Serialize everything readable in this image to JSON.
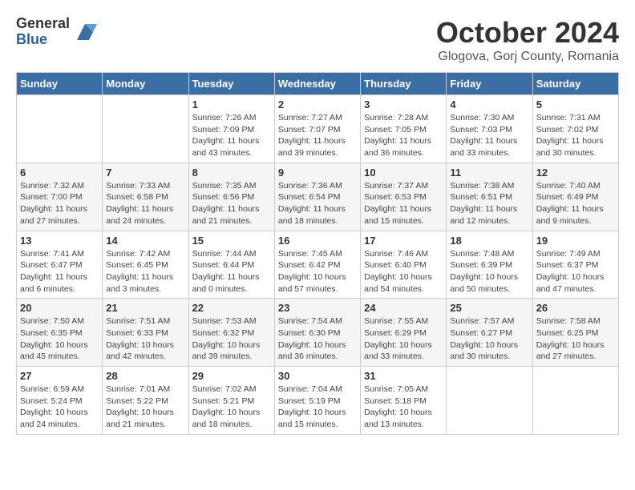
{
  "logo": {
    "general": "General",
    "blue": "Blue"
  },
  "header": {
    "month": "October 2024",
    "location": "Glogova, Gorj County, Romania"
  },
  "weekdays": [
    "Sunday",
    "Monday",
    "Tuesday",
    "Wednesday",
    "Thursday",
    "Friday",
    "Saturday"
  ],
  "weeks": [
    [
      {
        "day": "",
        "info": ""
      },
      {
        "day": "",
        "info": ""
      },
      {
        "day": "1",
        "info": "Sunrise: 7:26 AM\nSunset: 7:09 PM\nDaylight: 11 hours and 43 minutes."
      },
      {
        "day": "2",
        "info": "Sunrise: 7:27 AM\nSunset: 7:07 PM\nDaylight: 11 hours and 39 minutes."
      },
      {
        "day": "3",
        "info": "Sunrise: 7:28 AM\nSunset: 7:05 PM\nDaylight: 11 hours and 36 minutes."
      },
      {
        "day": "4",
        "info": "Sunrise: 7:30 AM\nSunset: 7:03 PM\nDaylight: 11 hours and 33 minutes."
      },
      {
        "day": "5",
        "info": "Sunrise: 7:31 AM\nSunset: 7:02 PM\nDaylight: 11 hours and 30 minutes."
      }
    ],
    [
      {
        "day": "6",
        "info": "Sunrise: 7:32 AM\nSunset: 7:00 PM\nDaylight: 11 hours and 27 minutes."
      },
      {
        "day": "7",
        "info": "Sunrise: 7:33 AM\nSunset: 6:58 PM\nDaylight: 11 hours and 24 minutes."
      },
      {
        "day": "8",
        "info": "Sunrise: 7:35 AM\nSunset: 6:56 PM\nDaylight: 11 hours and 21 minutes."
      },
      {
        "day": "9",
        "info": "Sunrise: 7:36 AM\nSunset: 6:54 PM\nDaylight: 11 hours and 18 minutes."
      },
      {
        "day": "10",
        "info": "Sunrise: 7:37 AM\nSunset: 6:53 PM\nDaylight: 11 hours and 15 minutes."
      },
      {
        "day": "11",
        "info": "Sunrise: 7:38 AM\nSunset: 6:51 PM\nDaylight: 11 hours and 12 minutes."
      },
      {
        "day": "12",
        "info": "Sunrise: 7:40 AM\nSunset: 6:49 PM\nDaylight: 11 hours and 9 minutes."
      }
    ],
    [
      {
        "day": "13",
        "info": "Sunrise: 7:41 AM\nSunset: 6:47 PM\nDaylight: 11 hours and 6 minutes."
      },
      {
        "day": "14",
        "info": "Sunrise: 7:42 AM\nSunset: 6:45 PM\nDaylight: 11 hours and 3 minutes."
      },
      {
        "day": "15",
        "info": "Sunrise: 7:44 AM\nSunset: 6:44 PM\nDaylight: 11 hours and 0 minutes."
      },
      {
        "day": "16",
        "info": "Sunrise: 7:45 AM\nSunset: 6:42 PM\nDaylight: 10 hours and 57 minutes."
      },
      {
        "day": "17",
        "info": "Sunrise: 7:46 AM\nSunset: 6:40 PM\nDaylight: 10 hours and 54 minutes."
      },
      {
        "day": "18",
        "info": "Sunrise: 7:48 AM\nSunset: 6:39 PM\nDaylight: 10 hours and 50 minutes."
      },
      {
        "day": "19",
        "info": "Sunrise: 7:49 AM\nSunset: 6:37 PM\nDaylight: 10 hours and 47 minutes."
      }
    ],
    [
      {
        "day": "20",
        "info": "Sunrise: 7:50 AM\nSunset: 6:35 PM\nDaylight: 10 hours and 45 minutes."
      },
      {
        "day": "21",
        "info": "Sunrise: 7:51 AM\nSunset: 6:33 PM\nDaylight: 10 hours and 42 minutes."
      },
      {
        "day": "22",
        "info": "Sunrise: 7:53 AM\nSunset: 6:32 PM\nDaylight: 10 hours and 39 minutes."
      },
      {
        "day": "23",
        "info": "Sunrise: 7:54 AM\nSunset: 6:30 PM\nDaylight: 10 hours and 36 minutes."
      },
      {
        "day": "24",
        "info": "Sunrise: 7:55 AM\nSunset: 6:29 PM\nDaylight: 10 hours and 33 minutes."
      },
      {
        "day": "25",
        "info": "Sunrise: 7:57 AM\nSunset: 6:27 PM\nDaylight: 10 hours and 30 minutes."
      },
      {
        "day": "26",
        "info": "Sunrise: 7:58 AM\nSunset: 6:25 PM\nDaylight: 10 hours and 27 minutes."
      }
    ],
    [
      {
        "day": "27",
        "info": "Sunrise: 6:59 AM\nSunset: 5:24 PM\nDaylight: 10 hours and 24 minutes."
      },
      {
        "day": "28",
        "info": "Sunrise: 7:01 AM\nSunset: 5:22 PM\nDaylight: 10 hours and 21 minutes."
      },
      {
        "day": "29",
        "info": "Sunrise: 7:02 AM\nSunset: 5:21 PM\nDaylight: 10 hours and 18 minutes."
      },
      {
        "day": "30",
        "info": "Sunrise: 7:04 AM\nSunset: 5:19 PM\nDaylight: 10 hours and 15 minutes."
      },
      {
        "day": "31",
        "info": "Sunrise: 7:05 AM\nSunset: 5:18 PM\nDaylight: 10 hours and 13 minutes."
      },
      {
        "day": "",
        "info": ""
      },
      {
        "day": "",
        "info": ""
      }
    ]
  ]
}
